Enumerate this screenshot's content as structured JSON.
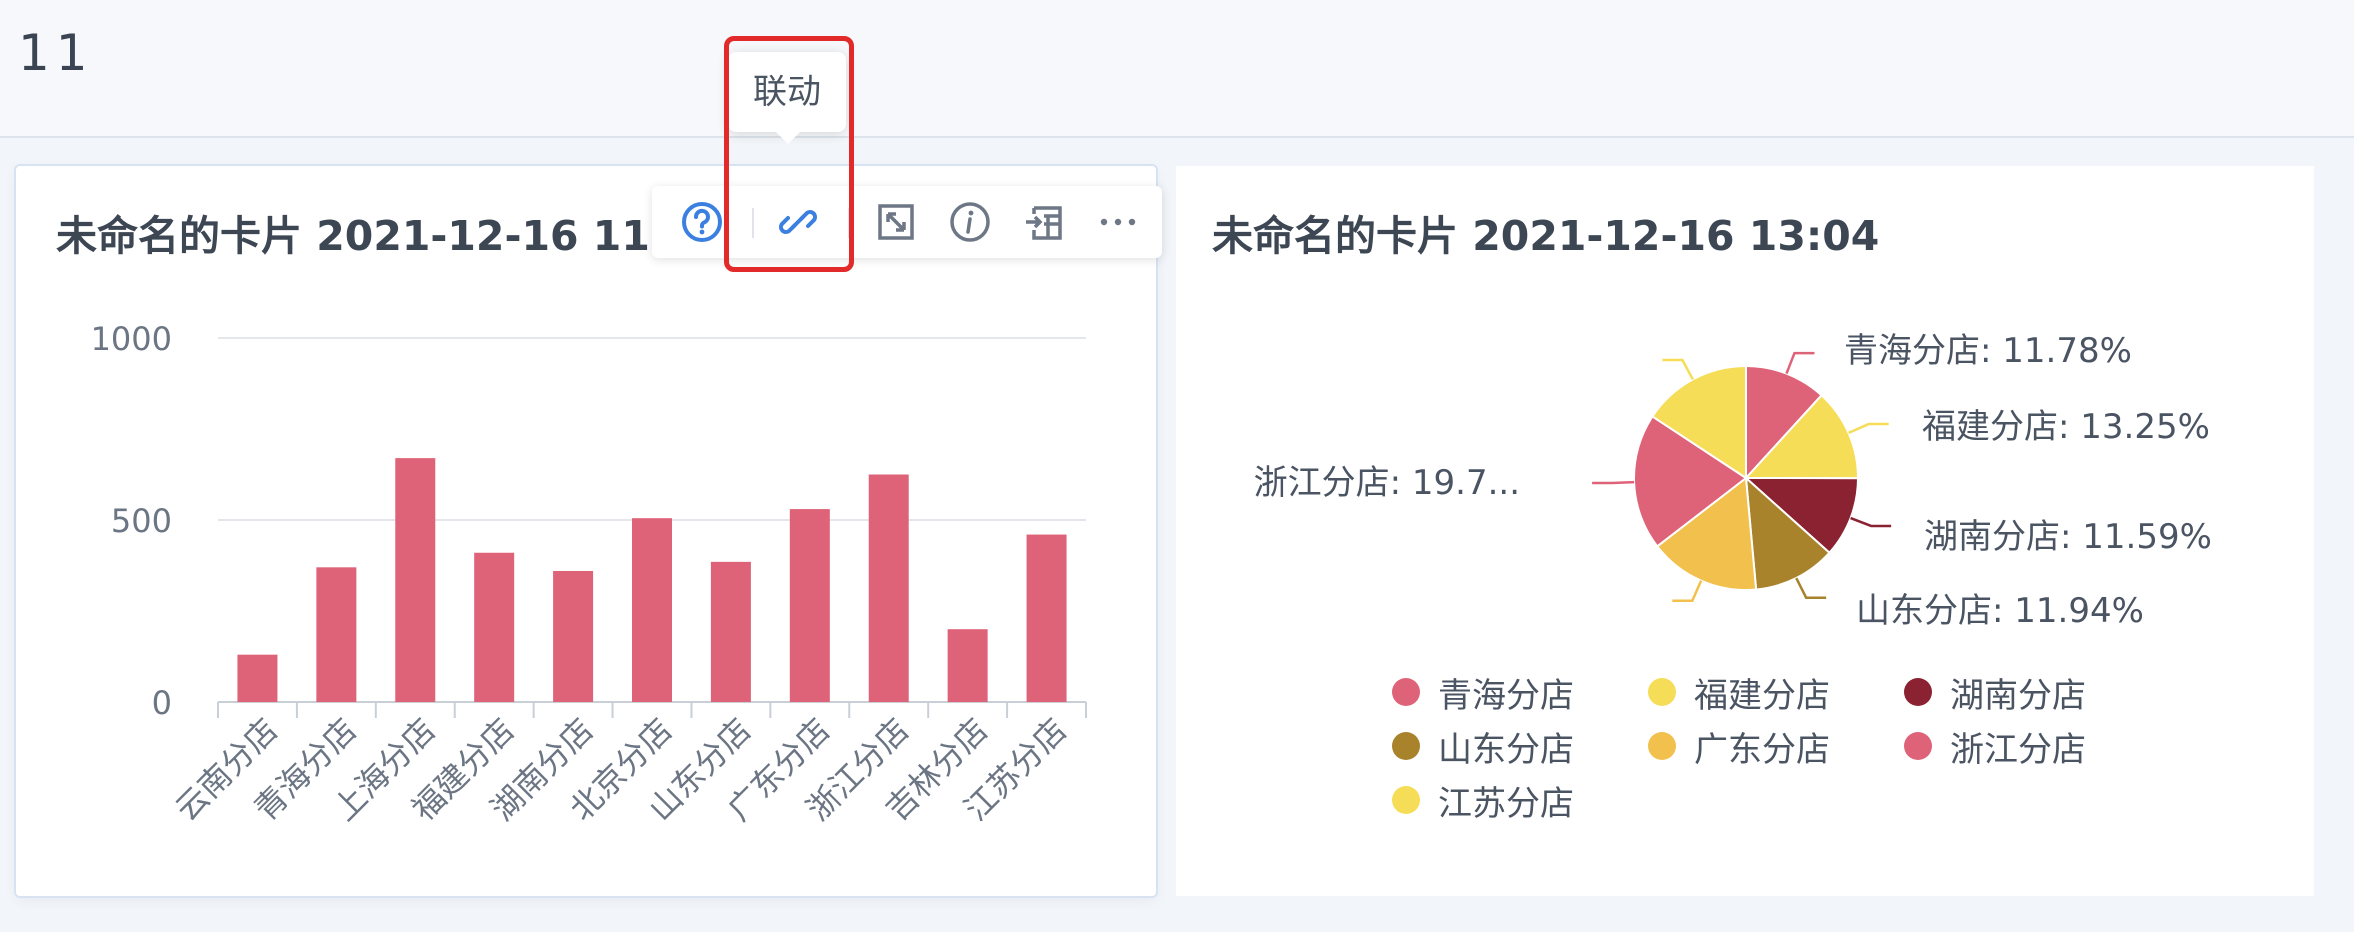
{
  "dashboard": {
    "title": "11"
  },
  "tooltip": {
    "label": "联动"
  },
  "toolbar": {
    "buttons": [
      {
        "name": "help-icon"
      },
      {
        "name": "link-icon"
      },
      {
        "name": "expand-icon"
      },
      {
        "name": "info-icon"
      },
      {
        "name": "export-icon"
      },
      {
        "name": "more-icon"
      }
    ]
  },
  "cards": [
    {
      "title": "未命名的卡片 2021-12-16 11:4"
    },
    {
      "title": "未命名的卡片 2021-12-16 13:04"
    }
  ],
  "chart_data": [
    {
      "type": "bar",
      "title": "",
      "categories": [
        "云南分店",
        "青海分店",
        "上海分店",
        "福建分店",
        "湖南分店",
        "北京分店",
        "山东分店",
        "广东分店",
        "浙江分店",
        "吉林分店",
        "江苏分店"
      ],
      "values": [
        130,
        370,
        670,
        410,
        360,
        505,
        385,
        530,
        625,
        200,
        460
      ],
      "yticks": [
        "0",
        "500",
        "1000"
      ],
      "ylim": [
        0,
        1000
      ],
      "grid": true,
      "color": "#de6378"
    },
    {
      "type": "pie",
      "title": "",
      "slices": [
        {
          "name": "青海分店",
          "value": 11.78,
          "label": "青海分店: 11.78%",
          "color": "#de6378"
        },
        {
          "name": "福建分店",
          "value": 13.25,
          "label": "福建分店: 13.25%",
          "color": "#f6dd57"
        },
        {
          "name": "湖南分店",
          "value": 11.59,
          "label": "湖南分店: 11.59%",
          "color": "#8b2232"
        },
        {
          "name": "山东分店",
          "value": 11.94,
          "label": "山东分店: 11.94%",
          "color": "#a8832c"
        },
        {
          "name": "广东分店",
          "value": 16.0,
          "label": "",
          "color": "#f2c04d"
        },
        {
          "name": "浙江分店",
          "value": 19.7,
          "label": "浙江分店: 19.7...",
          "color": "#de6378"
        },
        {
          "name": "江苏分店",
          "value": 15.74,
          "label": "",
          "color": "#f6dd57"
        }
      ],
      "legend_position": "bottom"
    }
  ]
}
